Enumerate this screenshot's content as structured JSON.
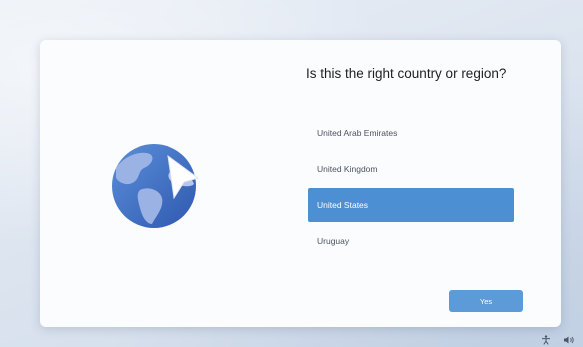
{
  "oobe": {
    "title": "Is this the right country or region?",
    "countries": [
      {
        "label": "United Arab Emirates",
        "selected": false
      },
      {
        "label": "United Kingdom",
        "selected": false
      },
      {
        "label": "United States",
        "selected": true
      },
      {
        "label": "Uruguay",
        "selected": false
      }
    ],
    "yes_label": "Yes"
  },
  "taskbar": {
    "icons": [
      "accessibility-icon",
      "volume-icon"
    ]
  },
  "colors": {
    "selection": "#4d8fd3",
    "button": "#5d9ad8",
    "globe_blue": "#3d6fc4",
    "globe_land": "#8ea7dc"
  }
}
